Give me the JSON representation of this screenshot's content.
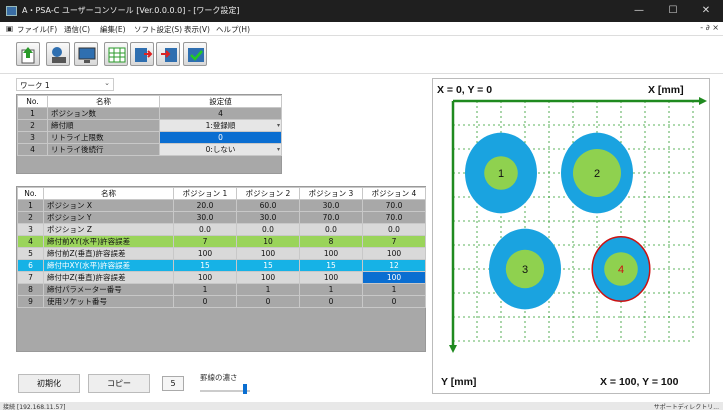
{
  "window": {
    "title": "A・PSA-C ユーザーコンソール [Ver.0.0.0.0] - [ワーク設定]",
    "min": "—",
    "max": "☐",
    "close": "✕"
  },
  "menu": {
    "items": [
      "ファイル(F)",
      "通信(C)",
      "編集(E)",
      "ソフト設定(S)",
      "表示(V)",
      "ヘルプ(H)"
    ],
    "mdi_controls": "- ∂ ×"
  },
  "toolbar": {
    "icons": [
      "upload-icon",
      "connect-icon",
      "monitor-icon",
      "grid-icon",
      "export-icon",
      "import-icon",
      "check-icon"
    ]
  },
  "work_select": {
    "value": "ワーク 1"
  },
  "settings_table": {
    "headers": [
      "No.",
      "名称",
      "設定値"
    ],
    "rows": [
      [
        "1",
        "ポジション数",
        "4"
      ],
      [
        "2",
        "締付順",
        "1:登録順"
      ],
      [
        "3",
        "リトライ上限数",
        "0"
      ],
      [
        "4",
        "リトライ後続行",
        "0:しない"
      ]
    ]
  },
  "position_table": {
    "headers": [
      "No.",
      "名称",
      "ポジション 1",
      "ポジション 2",
      "ポジション 3",
      "ポジション 4"
    ],
    "rows": [
      [
        "1",
        "ポジション X",
        "20.0",
        "60.0",
        "30.0",
        "70.0"
      ],
      [
        "2",
        "ポジション Y",
        "30.0",
        "30.0",
        "70.0",
        "70.0"
      ],
      [
        "3",
        "ポジション Z",
        "0.0",
        "0.0",
        "0.0",
        "0.0"
      ],
      [
        "4",
        "締付前XY(水平)許容誤差",
        "7",
        "10",
        "8",
        "7"
      ],
      [
        "5",
        "締付前Z(垂直)許容誤差",
        "100",
        "100",
        "100",
        "100"
      ],
      [
        "6",
        "締付中XY(水平)許容誤差",
        "15",
        "15",
        "15",
        "12"
      ],
      [
        "7",
        "締付中Z(垂直)許容誤差",
        "100",
        "100",
        "100",
        "100"
      ],
      [
        "8",
        "締付パラメーター番号",
        "1",
        "1",
        "1",
        "1"
      ],
      [
        "9",
        "使用ソケット番号",
        "0",
        "0",
        "0",
        "0"
      ]
    ]
  },
  "bottom": {
    "init_label": "初期化",
    "copy_label": "コピー",
    "count_value": "5",
    "density_label": "罫線の濃さ"
  },
  "status": {
    "left": "接続 [192.168.11.57]",
    "right": "サポートディレクトリ..."
  },
  "plot": {
    "origin_label": "X = 0, Y = 0",
    "x_axis_label": "X [mm]",
    "y_axis_label": "Y [mm]",
    "end_label": "X = 100, Y = 100",
    "x_range": [
      0,
      100
    ],
    "y_range": [
      0,
      100
    ],
    "colors": {
      "axis": "#1f8a1f",
      "outer": "#1aa3e0",
      "inner": "#8fd14f",
      "selected_ring": "#cc1111",
      "grid": "#2a9a2a"
    },
    "positions": [
      {
        "label": "1",
        "x": 20,
        "y": 30,
        "outer_r": 15,
        "inner_r": 7
      },
      {
        "label": "2",
        "x": 60,
        "y": 30,
        "outer_r": 15,
        "inner_r": 10
      },
      {
        "label": "3",
        "x": 30,
        "y": 70,
        "outer_r": 15,
        "inner_r": 8
      },
      {
        "label": "4",
        "x": 70,
        "y": 70,
        "outer_r": 12,
        "inner_r": 7,
        "selected": true
      }
    ]
  }
}
